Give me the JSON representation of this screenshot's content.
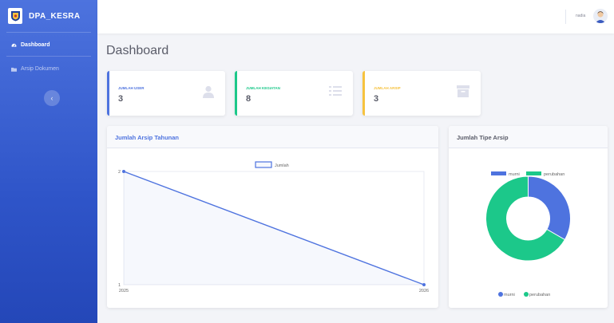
{
  "brand": {
    "name": "DPA_KESRA"
  },
  "sidebar": {
    "items": [
      {
        "label": "Dashboard",
        "icon": "gauge-icon",
        "active": true
      },
      {
        "label": "Arsip Dokumen",
        "icon": "folder-icon",
        "active": false
      }
    ],
    "toggle_icon": "chevron-left-icon"
  },
  "topbar": {
    "user_name": "nadia"
  },
  "page": {
    "title": "Dashboard"
  },
  "stats": [
    {
      "label": "JUMLAH USER",
      "value": "3",
      "color": "#4e73df",
      "icon": "user-icon"
    },
    {
      "label": "JUMLAH KEGIATAN",
      "value": "8",
      "color": "#1cc88a",
      "icon": "list-icon"
    },
    {
      "label": "JUMLAH ARSIP",
      "value": "3",
      "color": "#f6c23e",
      "icon": "archive-icon"
    }
  ],
  "line_panel": {
    "title": "Jumlah Arsip Tahunan"
  },
  "pie_panel": {
    "title": "Jumlah Tipe Arsip"
  },
  "chart_data": [
    {
      "type": "line",
      "x": [
        "2025",
        "2026"
      ],
      "series": [
        {
          "name": "Jumlah",
          "values": [
            2,
            1
          ],
          "color": "#4e73df"
        }
      ],
      "ylim": [
        1,
        2
      ],
      "yticks": [
        "1",
        "2"
      ],
      "legend": "top"
    },
    {
      "type": "pie",
      "categories": [
        "murni",
        "perubahan"
      ],
      "values": [
        1,
        2
      ],
      "colors": [
        "#4e73df",
        "#1cc88a"
      ],
      "legend": [
        "top",
        "bottom"
      ]
    }
  ]
}
